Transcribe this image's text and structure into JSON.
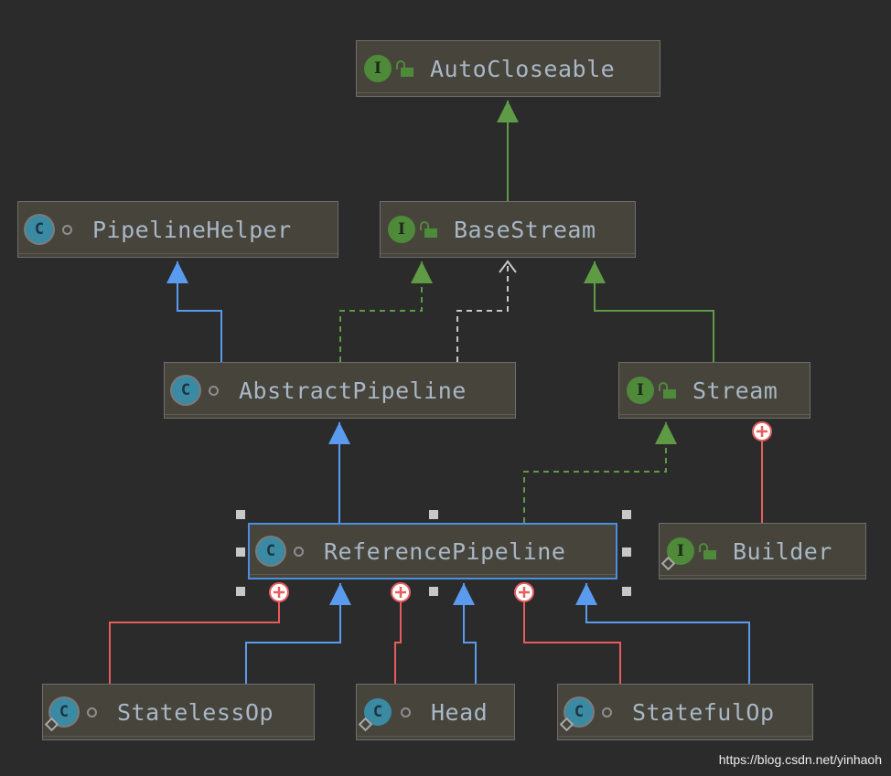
{
  "nodes": {
    "autocloseable": {
      "label": "AutoCloseable",
      "kind": "interface"
    },
    "basestream": {
      "label": "BaseStream",
      "kind": "interface"
    },
    "pipelinehelper": {
      "label": "PipelineHelper",
      "kind": "abstract-class"
    },
    "abstractpipeline": {
      "label": "AbstractPipeline",
      "kind": "abstract-class"
    },
    "stream": {
      "label": "Stream",
      "kind": "interface"
    },
    "referencepipeline": {
      "label": "ReferencePipeline",
      "kind": "abstract-class",
      "selected": true
    },
    "builder": {
      "label": "Builder",
      "kind": "interface"
    },
    "statelessop": {
      "label": "StatelessOp",
      "kind": "abstract-class"
    },
    "head": {
      "label": "Head",
      "kind": "class"
    },
    "statefulop": {
      "label": "StatefulOp",
      "kind": "abstract-class"
    }
  },
  "icon_letters": {
    "class": "C",
    "interface": "I"
  },
  "colors": {
    "extends": "#5a9bf0",
    "implements": "#5f9a45",
    "inner": "#e85c5c",
    "background": "#2b2b2b"
  },
  "watermark": "https://blog.csdn.net/yinhaoh"
}
